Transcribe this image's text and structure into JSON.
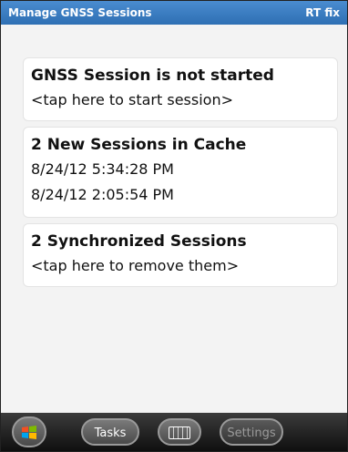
{
  "window": {
    "title": "Manage GNSS Sessions",
    "status": "RT fix"
  },
  "cards": {
    "session": {
      "heading": "GNSS Session is not started",
      "action": "<tap here to start session>"
    },
    "cache": {
      "heading": "2 New Sessions in Cache",
      "items": [
        "8/24/12 5:34:28 PM",
        "8/24/12 2:05:54 PM"
      ]
    },
    "synced": {
      "heading": "2 Synchronized Sessions",
      "action": "<tap here to remove them>"
    }
  },
  "taskbar": {
    "start_icon": "windows-logo-icon",
    "tasks_label": "Tasks",
    "keyboard_icon": "keyboard-icon",
    "settings_label": "Settings"
  },
  "colors": {
    "titlebar": "#3a7dc2",
    "content_bg": "#f3f3f3",
    "taskbar": "#1e1e1e"
  }
}
